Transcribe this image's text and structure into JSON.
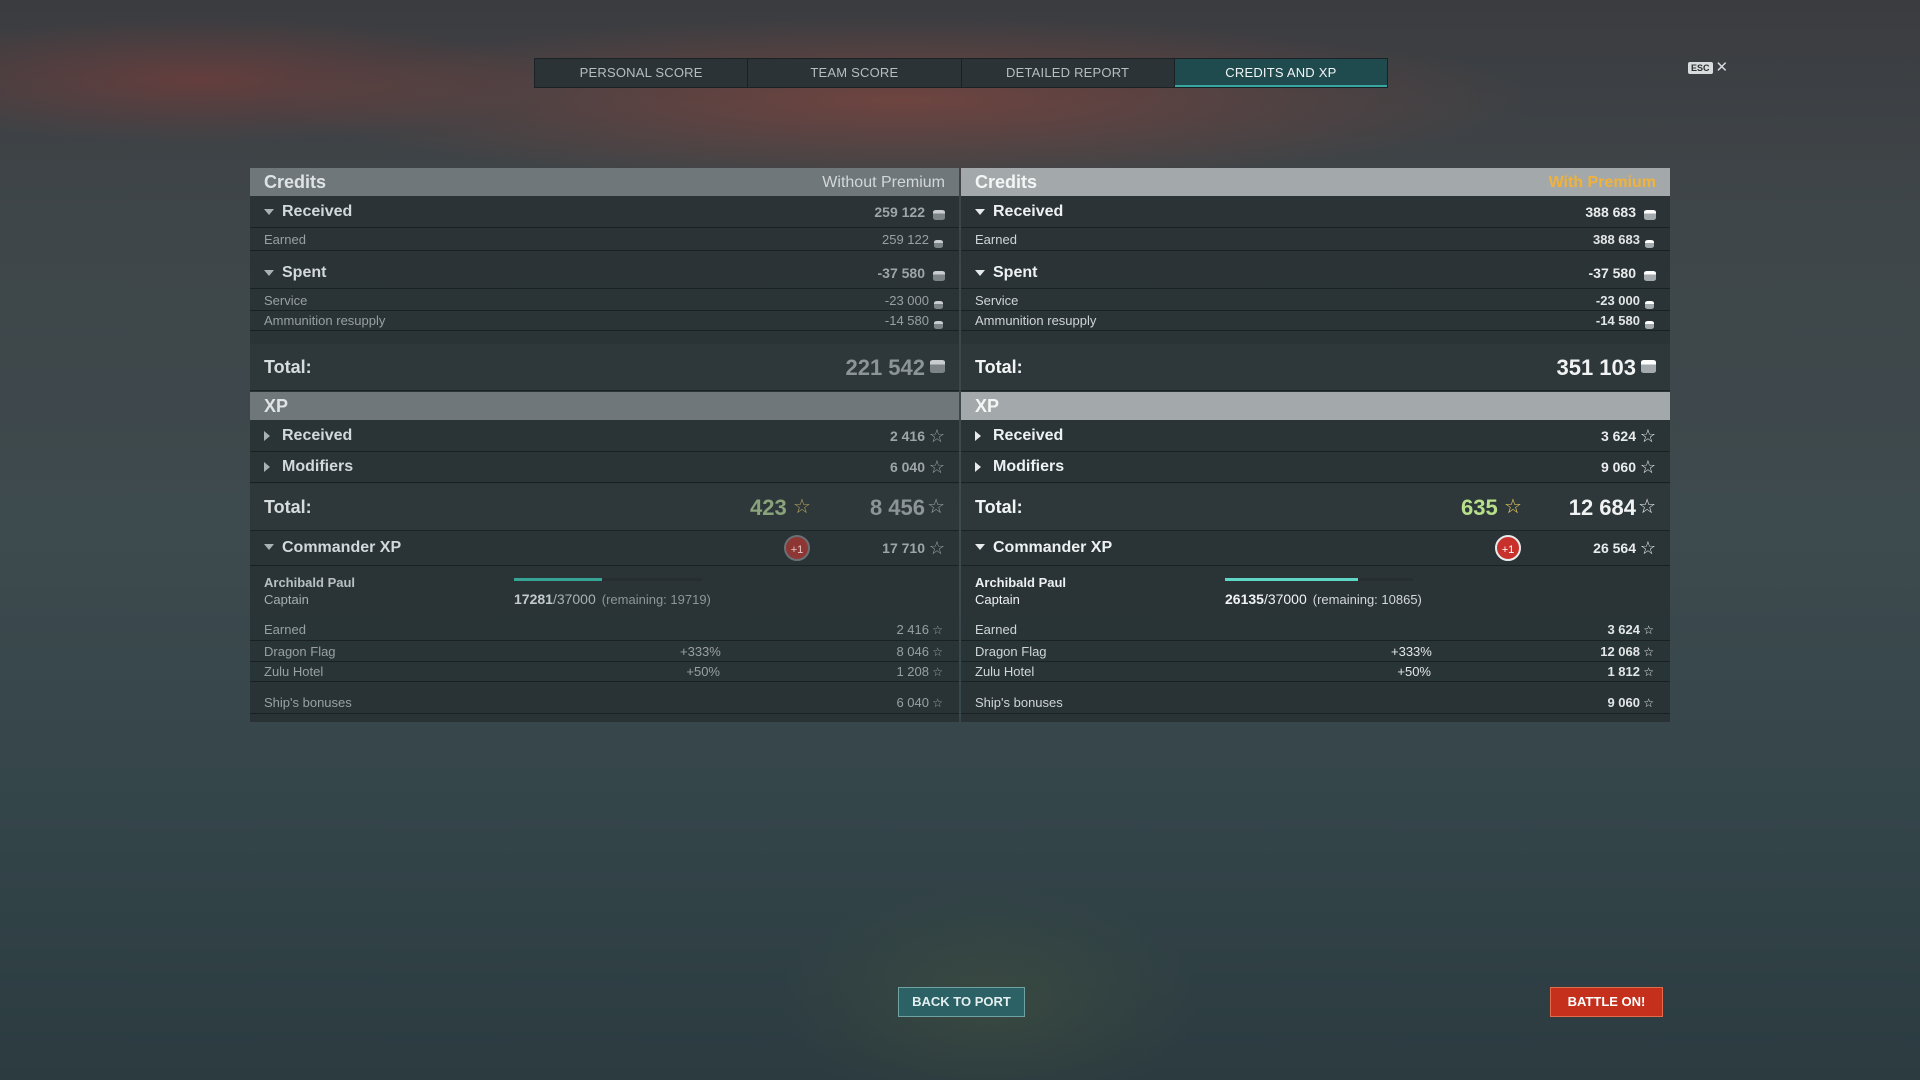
{
  "tabs": [
    "PERSONAL SCORE",
    "TEAM SCORE",
    "DETAILED REPORT",
    "CREDITS AND XP"
  ],
  "active_tab": "CREDITS AND XP",
  "esc": {
    "key": "ESC",
    "close": "✕"
  },
  "left": {
    "credits_title": "Credits",
    "credits_subtitle": "Without Premium",
    "received_label": "Received",
    "received_value": "259 122",
    "earned_label": "Earned",
    "earned_value": "259 122",
    "spent_label": "Spent",
    "spent_value": "-37 580",
    "service_label": "Service",
    "service_value": "-23 000",
    "ammo_label": "Ammunition resupply",
    "ammo_value": "-14 580",
    "total_label": "Total:",
    "total_value": "221 542",
    "xp_title": "XP",
    "xp_received_label": "Received",
    "xp_received_value": "2 416",
    "modifiers_label": "Modifiers",
    "modifiers_value": "6 040",
    "xp_total_label": "Total:",
    "free_xp": "423",
    "xp_total_value": "8 456",
    "commander_xp_label": "Commander XP",
    "badge": "+1",
    "commander_xp_value": "17 710",
    "commander_name": "Archibald Paul",
    "commander_rank": "Captain",
    "commander_progress": 0.467,
    "commander_current": "17281",
    "commander_max": "/37000",
    "commander_remaining": "(remaining: 19719)",
    "cx_earned_label": "Earned",
    "cx_earned_value": "2 416",
    "flag1_label": "Dragon Flag",
    "flag1_pct": "+333%",
    "flag1_value": "8 046",
    "flag2_label": "Zulu Hotel",
    "flag2_pct": "+50%",
    "flag2_value": "1 208",
    "ship_bonus_label": "Ship's bonuses",
    "ship_bonus_value": "6 040"
  },
  "right": {
    "credits_title": "Credits",
    "credits_subtitle": "With Premium",
    "received_label": "Received",
    "received_value": "388 683",
    "earned_label": "Earned",
    "earned_value": "388 683",
    "spent_label": "Spent",
    "spent_value": "-37 580",
    "service_label": "Service",
    "service_value": "-23 000",
    "ammo_label": "Ammunition resupply",
    "ammo_value": "-14 580",
    "total_label": "Total:",
    "total_value": "351 103",
    "xp_title": "XP",
    "xp_received_label": "Received",
    "xp_received_value": "3 624",
    "modifiers_label": "Modifiers",
    "modifiers_value": "9 060",
    "xp_total_label": "Total:",
    "free_xp": "635",
    "xp_total_value": "12 684",
    "commander_xp_label": "Commander XP",
    "badge": "+1",
    "commander_xp_value": "26 564",
    "commander_name": "Archibald Paul",
    "commander_rank": "Captain",
    "commander_progress": 0.706,
    "commander_current": "26135",
    "commander_max": "/37000",
    "commander_remaining": "(remaining: 10865)",
    "cx_earned_label": "Earned",
    "cx_earned_value": "3 624",
    "flag1_label": "Dragon Flag",
    "flag1_pct": "+333%",
    "flag1_value": "12 068",
    "flag2_label": "Zulu Hotel",
    "flag2_pct": "+50%",
    "flag2_value": "1 812",
    "ship_bonus_label": "Ship's bonuses",
    "ship_bonus_value": "9 060"
  },
  "buttons": {
    "back_to_port": "BACK TO PORT",
    "battle_on": "BATTLE ON!"
  },
  "colors": {
    "premium": "#f0b23a",
    "active_tab": "#1f4b4e",
    "battle_button": "#c4301c",
    "port_button": "#2c6266"
  }
}
